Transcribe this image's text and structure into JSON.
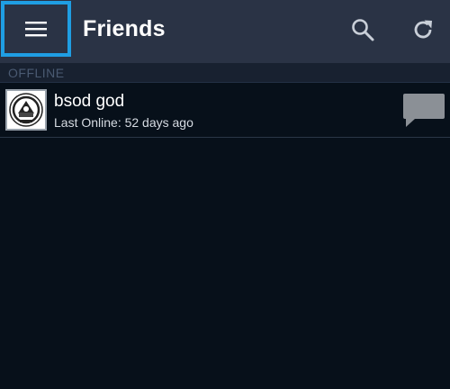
{
  "appbar": {
    "title": "Friends",
    "menu_icon": "hamburger-menu-icon",
    "search_icon": "search-icon",
    "refresh_icon": "refresh-icon"
  },
  "sections": [
    {
      "label": "OFFLINE",
      "friends": [
        {
          "name": "bsod god",
          "status": "Last Online: 52 days ago",
          "avatar_icon": "emblem-avatar",
          "chat_icon": "chat-bubble-icon"
        }
      ]
    }
  ],
  "colors": {
    "appbar_bg": "#2a3345",
    "highlight": "#1f9ee3",
    "background": "#07101a",
    "section_text": "#4a5a72"
  }
}
